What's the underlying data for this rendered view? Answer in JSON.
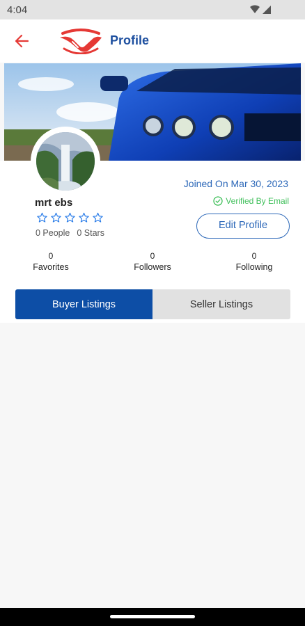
{
  "status_bar": {
    "time": "4:04",
    "icons": [
      "wifi-icon",
      "signal-icon"
    ]
  },
  "header": {
    "title": "Profile",
    "back_icon": "arrow-left-icon",
    "logo": "handshake-logo"
  },
  "profile": {
    "username": "mrt ebs",
    "rating": 0,
    "max_rating": 5,
    "people_text": "0 People",
    "stars_text": "0 Stars",
    "joined_text": "Joined On Mar 30, 2023",
    "verified_text": "Verified By Email",
    "edit_button": "Edit Profile"
  },
  "stats": [
    {
      "value": "0",
      "label": "Favorites"
    },
    {
      "value": "0",
      "label": "Followers"
    },
    {
      "value": "0",
      "label": "Following"
    }
  ],
  "tabs": [
    {
      "label": "Buyer Listings",
      "active": true
    },
    {
      "label": "Seller Listings",
      "active": false
    }
  ],
  "colors": {
    "brand_blue": "#1d4f9f",
    "accent_red": "#e53935",
    "link_blue": "#2b67b8",
    "verified_green": "#3fbf5a",
    "tab_active": "#0d4ea6"
  }
}
